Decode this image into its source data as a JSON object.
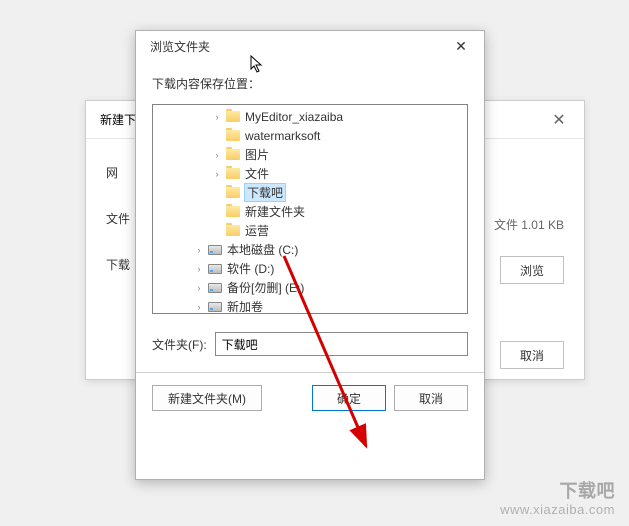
{
  "bg": {
    "title": "新建下",
    "labels": {
      "url": "网",
      "file": "文件",
      "download": "下载"
    },
    "filesize": "文件 1.01 KB",
    "browse": "浏览",
    "cancel": "取消"
  },
  "dialog": {
    "title": "浏览文件夹",
    "subtitle": "下载内容保存位置：",
    "tree": [
      {
        "label": "MyEditor_xiazaiba",
        "level": 2,
        "icon": "folder",
        "expand": "closed"
      },
      {
        "label": "watermarksoft",
        "level": 2,
        "icon": "folder",
        "expand": "none"
      },
      {
        "label": "图片",
        "level": 2,
        "icon": "folder",
        "expand": "closed"
      },
      {
        "label": "文件",
        "level": 2,
        "icon": "folder",
        "expand": "closed"
      },
      {
        "label": "下载吧",
        "level": 2,
        "icon": "folder",
        "expand": "none",
        "selected": true
      },
      {
        "label": "新建文件夹",
        "level": 2,
        "icon": "folder",
        "expand": "none"
      },
      {
        "label": "运营",
        "level": 2,
        "icon": "folder",
        "expand": "none"
      },
      {
        "label": "本地磁盘 (C:)",
        "level": 1,
        "icon": "drive",
        "expand": "closed"
      },
      {
        "label": "软件 (D:)",
        "level": 1,
        "icon": "drive",
        "expand": "closed"
      },
      {
        "label": "备份[勿删] (E:)",
        "level": 1,
        "icon": "drive",
        "expand": "closed"
      },
      {
        "label": "新加卷",
        "level": 1,
        "icon": "drive",
        "expand": "closed"
      }
    ],
    "folder_label": "文件夹(F):",
    "folder_value": "下载吧",
    "new_folder": "新建文件夹(M)",
    "ok": "确定",
    "cancel": "取消"
  },
  "watermark": {
    "brand": "下载吧",
    "url": "www.xiazaiba.com"
  }
}
